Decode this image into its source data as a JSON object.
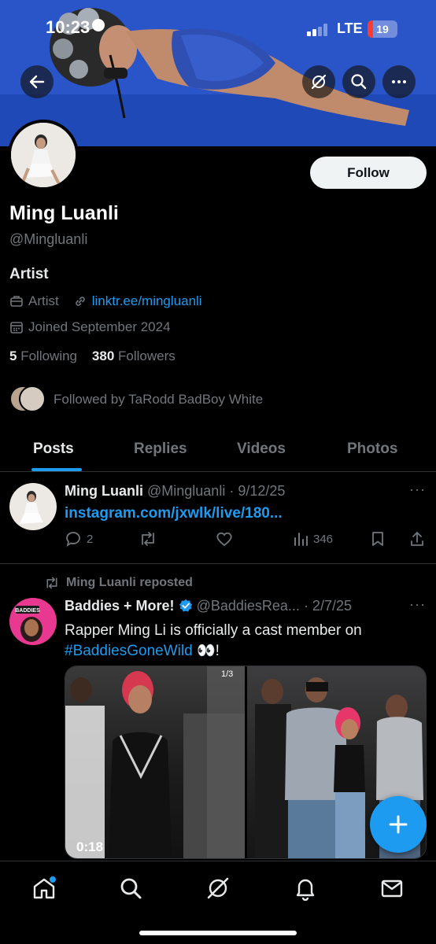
{
  "status_bar": {
    "time": "10:23",
    "network": "LTE",
    "battery": "19"
  },
  "header": {
    "back_icon": "arrow-left-icon",
    "grok_icon": "grok-icon",
    "search_icon": "search-icon",
    "more_icon": "more-icon"
  },
  "profile": {
    "follow_label": "Follow",
    "name": "Ming Luanli",
    "handle": "@Mingluanli",
    "bio": "Artist",
    "category": "Artist",
    "link": "linktr.ee/mingluanli",
    "joined": "Joined September 2024",
    "following_count": "5",
    "following_label": "Following",
    "followers_count": "380",
    "followers_label": "Followers",
    "followed_by": "Followed by TaRodd BadBoy White"
  },
  "tabs": [
    {
      "label": "Posts",
      "active": true
    },
    {
      "label": "Replies",
      "active": false
    },
    {
      "label": "Videos",
      "active": false
    },
    {
      "label": "Photos",
      "active": false
    }
  ],
  "posts": [
    {
      "author": "Ming Luanli",
      "handle": "@Mingluanli",
      "date": "· 9/12/25",
      "text": "instagram.com/jxwlk/live/180...",
      "replies": "2",
      "views": "346"
    },
    {
      "repost_label": "Ming Luanli reposted",
      "author": "Baddies + More!",
      "handle": "@BaddiesRea...",
      "date": "· 2/7/25",
      "text_main": "Rapper Ming Li is officially a cast member on",
      "hashtag": "#BaddiesGoneWild",
      "emoji": "👀!",
      "media_duration": "0:18",
      "media_counter": "1/3",
      "avatar_text": "BADDIES"
    }
  ],
  "colors": {
    "accent": "#1d9bf0",
    "muted": "#71767b",
    "text": "#e7e9ea",
    "background": "#000000"
  }
}
